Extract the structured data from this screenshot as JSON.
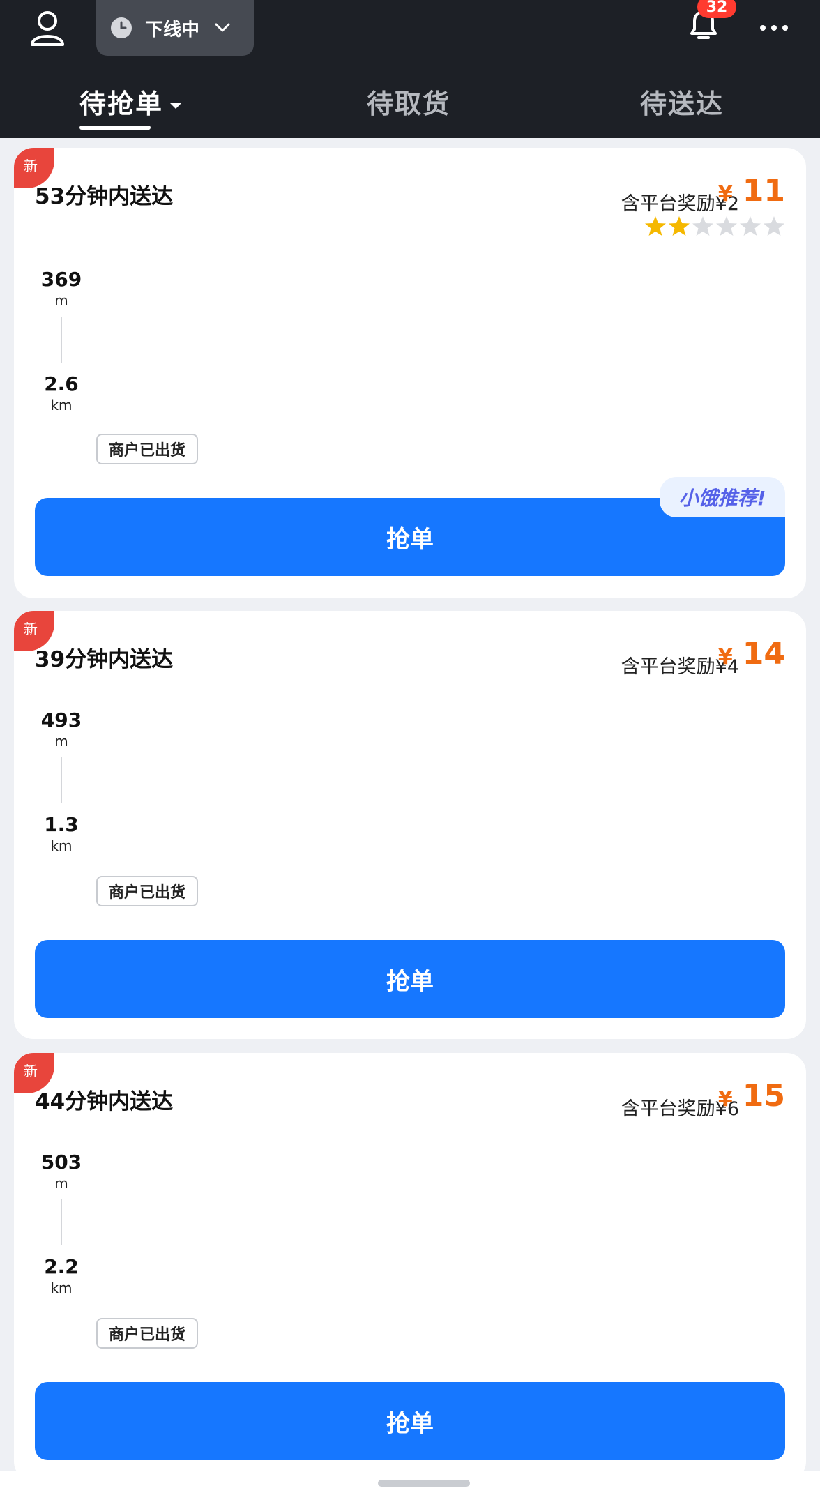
{
  "header": {
    "status_label": "下线中",
    "notification_count": "32",
    "tabs": [
      {
        "label": "待抢单",
        "active": true
      },
      {
        "label": "待取货",
        "active": false
      },
      {
        "label": "待送达",
        "active": false
      }
    ]
  },
  "orders": [
    {
      "badge": "新",
      "deliver_time": "53分钟内送达",
      "reward": "含平台奖励¥2",
      "currency": "¥",
      "price": "11",
      "rating": 2,
      "rating_max": 6,
      "pickup_distance": {
        "value": "369",
        "unit": "m"
      },
      "delivery_distance": {
        "value": "2.6",
        "unit": "km"
      },
      "status_tag": "商户已出货",
      "recommend_tag": "小饿推荐!",
      "button_label": "抢单"
    },
    {
      "badge": "新",
      "deliver_time": "39分钟内送达",
      "reward": "含平台奖励¥4",
      "currency": "¥",
      "price": "14",
      "pickup_distance": {
        "value": "493",
        "unit": "m"
      },
      "delivery_distance": {
        "value": "1.3",
        "unit": "km"
      },
      "status_tag": "商户已出货",
      "button_label": "抢单"
    },
    {
      "badge": "新",
      "deliver_time": "44分钟内送达",
      "reward": "含平台奖励¥6",
      "currency": "¥",
      "price": "15",
      "pickup_distance": {
        "value": "503",
        "unit": "m"
      },
      "delivery_distance": {
        "value": "2.2",
        "unit": "km"
      },
      "status_tag": "商户已出货",
      "button_label": "抢单"
    }
  ],
  "colors": {
    "header_bg": "#1d2026",
    "primary_button": "#1677ff",
    "price": "#f06b11",
    "new_badge": "#e8453c",
    "star_filled": "#f5b800",
    "star_empty": "#d9dbdf"
  },
  "icons": {
    "avatar": "user-outline-icon",
    "status": "clock-icon",
    "dropdown": "chevron-down-icon",
    "notifications": "bell-icon",
    "more": "more-dots-icon"
  }
}
